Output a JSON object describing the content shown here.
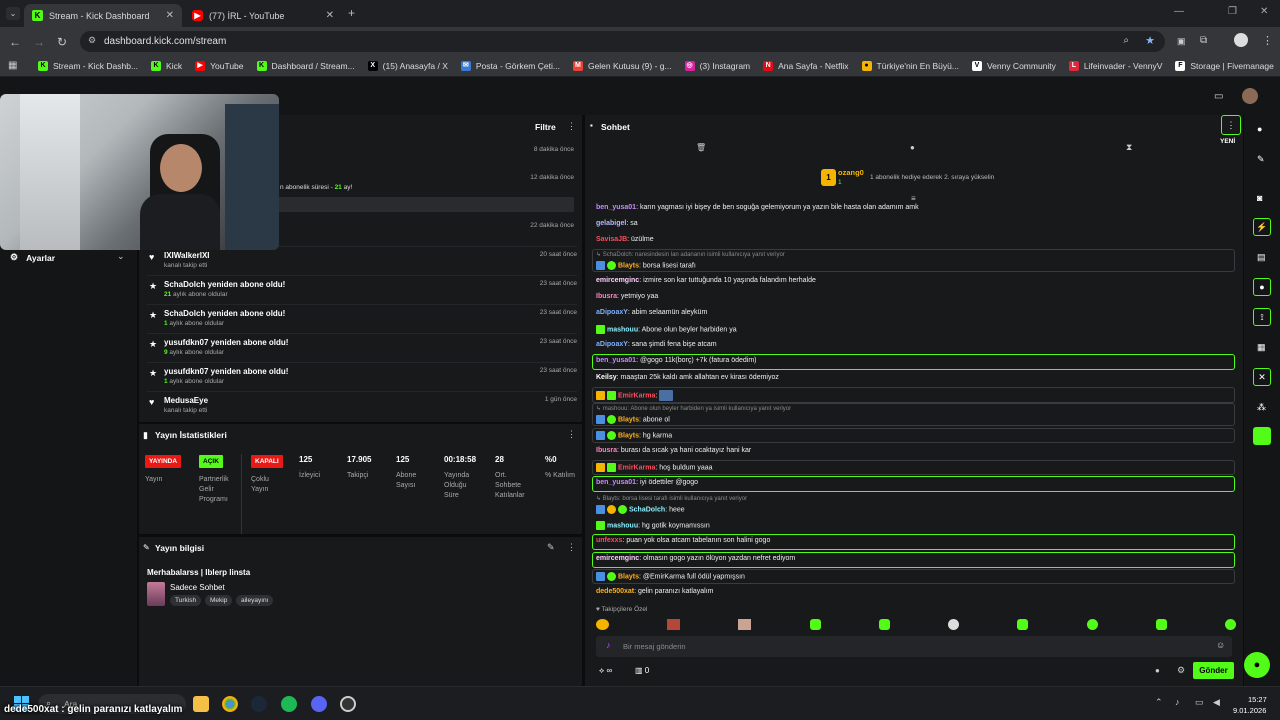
{
  "browser": {
    "tabs": [
      {
        "label": "Stream - Kick Dashboard",
        "icon": "kick-icon"
      },
      {
        "label": "(77) İRL - YouTube",
        "icon": "youtube-icon"
      }
    ],
    "url": "dashboard.kick.com/stream",
    "bookmarks": [
      "Stream - Kick Dashb...",
      "Kick",
      "YouTube",
      "Dashboard / Stream...",
      "(15) Anasayfa / X",
      "Posta - Görkem Çeti...",
      "Gelen Kutusu (9) - g...",
      "(3) Instagram",
      "Ana Sayfa - Netflix",
      "Türkiye'nin En Büyü...",
      "Venny Community",
      "Lifeinvader - VennyV",
      "Storage | Fivemanage"
    ]
  },
  "sidebar": {
    "settings_label": "Ayarlar"
  },
  "activity": {
    "title": "Filtre",
    "top_times": [
      "8 dakika önce",
      "12 dakika önce",
      "22 dakika önce"
    ],
    "sub_fragment_prefix": "n abonelik süresi - ",
    "sub_fragment_months": "21",
    "sub_fragment_suffix": " ay!",
    "events": [
      {
        "title": "IXIWalkerIXI",
        "sub": "kanalı takip etti",
        "time": "20 saat önce",
        "icon": "heart-icon"
      },
      {
        "title": "SchaDolch yeniden abone oldu!",
        "sub_num": "21",
        "sub": " aylık abone oldular",
        "time": "23 saat önce",
        "icon": "star-icon"
      },
      {
        "title": "SchaDolch yeniden abone oldu!",
        "sub_num": "1",
        "sub": " aylık abone oldular",
        "time": "23 saat önce",
        "icon": "star-icon"
      },
      {
        "title": "yusufdkn07 yeniden abone oldu!",
        "sub_num": "9",
        "sub": " aylık abone oldular",
        "time": "23 saat önce",
        "icon": "star-icon"
      },
      {
        "title": "yusufdkn07 yeniden abone oldu!",
        "sub_num": "1",
        "sub": " aylık abone oldular",
        "time": "23 saat önce",
        "icon": "star-icon"
      },
      {
        "title": "MedusaEye",
        "sub": "kanalı takip etti",
        "time": "1 gün önce",
        "icon": "heart-icon"
      }
    ]
  },
  "stats": {
    "title": "Yayın İstatistikleri",
    "badges": [
      {
        "badge": "YAYINDA",
        "label": "Yayın",
        "color": "#e91916"
      },
      {
        "badge": "AÇIK",
        "label": "Partnerlik Gelir Programı",
        "color": "#53fc18"
      },
      {
        "badge": "KAPALI",
        "label": "Çoklu Yayın",
        "color": "#e91916"
      }
    ],
    "numbers": [
      {
        "value": "125",
        "label": "İzleyici"
      },
      {
        "value": "17.905",
        "label": "Takipçi"
      },
      {
        "value": "125",
        "label": "Abone Sayısı"
      },
      {
        "value": "00:18:58",
        "label": "Yayında Olduğu Süre"
      },
      {
        "value": "28",
        "label": "Ort. Sohbete Katılanlar"
      },
      {
        "value": "%0",
        "label": "% Katılım"
      }
    ]
  },
  "info": {
    "title": "Yayın bilgisi",
    "stream_title": "Merhabalarss | Iblerp linsta",
    "category": "Sadece Sohbet",
    "tags": [
      "Turkish",
      "Mekip",
      "aileyayını"
    ]
  },
  "chat": {
    "title": "Sohbet",
    "new_label": "YENİ",
    "pinned_user": "ozang0",
    "pinned_count": "1",
    "pinned_text": "1 abonelik hediye ederek 2. sıraya yükselin",
    "messages": [
      {
        "user": "ben_yusa01",
        "color": "#c38bff",
        "text": "karın yagması iyi bişey de ben soguğa gelemiyorum ya yazın bile hasta olan adamım amk"
      },
      {
        "user": "gelabigel",
        "color": "#b9b9ff",
        "text": "sa"
      },
      {
        "user": "SavisaJB",
        "color": "#ff4b5c",
        "text": "üzülme"
      },
      {
        "reply": "SchaDolch: naresindesin lan adananın isimli kullanıcıya yanıt veriyor",
        "user": "Blayts",
        "color": "#ffb21f",
        "text": "borsa lisesi tarafı"
      },
      {
        "user": "emircemginc",
        "color": "#ffd0ff",
        "text": "izmire son kar tuttuğunda 10 yaşında falandım herhalde"
      },
      {
        "user": "Ibusra",
        "color": "#ff86c1",
        "text": "yetmiyo yaa"
      },
      {
        "user": "aDipoaxY",
        "color": "#7fb0ff",
        "text": "abim selaamün aleyküm"
      },
      {
        "user": "mashouu",
        "color": "#8ef0ff",
        "text": "Abone olun beyler harbiden ya"
      },
      {
        "user": "aDipoaxY",
        "color": "#7fb0ff",
        "text": "sana şimdi fena bişe atcam"
      },
      {
        "user": "ben_yusa01",
        "color": "#c38bff",
        "text": "@gogo 11k(borç) +7k (fatura ödedim)"
      },
      {
        "user": "Keilsy",
        "color": "#ffffff",
        "text": "maaştan 25k kaldı amk allahtan ev kirası ödemiyoz"
      },
      {
        "user": "EmirKarma",
        "color": "#ff4b5c",
        "text": ""
      },
      {
        "reply": "mashouu: Abone olun beyler harbiden ya isimli kullanıcıya yanıt veriyor",
        "user": "Blayts",
        "color": "#ffb21f",
        "text": "abone ol"
      },
      {
        "user": "Blayts",
        "color": "#ffb21f",
        "text": "hg karma"
      },
      {
        "user": "Ibusra",
        "color": "#ff86c1",
        "text": "burası da sıcak ya hani ocaktayız hani kar"
      },
      {
        "user": "EmirKarma",
        "color": "#ff4b5c",
        "text": "hoş buldum yaaa"
      },
      {
        "user": "ben_yusa01",
        "color": "#c38bff",
        "text": "iyi ödettiler @gogo"
      },
      {
        "reply": "Blayts: borsa lisesi tarafı isimli kullanıcıya yanıt veriyor",
        "user": "SchaDolch",
        "color": "#8ef0ff",
        "text": "heee"
      },
      {
        "user": "mashouu",
        "color": "#8ef0ff",
        "text": "hg gotik koymamıssın"
      },
      {
        "user": "unfexxs",
        "color": "#ff4b5c",
        "text": "puan yok olsa atcam tabelanın son halini gogo"
      },
      {
        "user": "emircemginc",
        "color": "#ffd0ff",
        "text": "olmasın gogo yazın ölüyon yazdan nefret ediyom"
      },
      {
        "user": "Blayts",
        "color": "#ffb21f",
        "text": "@EmirKarma full ödül yapmışsın"
      },
      {
        "user": "dede500xat",
        "color": "#ffb21f",
        "text": "gelin paranızı katlayalım"
      }
    ],
    "followers_label": "Takipçilere Özel",
    "input_placeholder": "Bir mesaj gönderin",
    "infinite": "∞",
    "zero": "0",
    "send_label": "Gönder"
  },
  "taskbar": {
    "search": "Ara",
    "overlay_user": "dede500xat",
    "overlay_text": "gelin paranızı katlayalım",
    "time": "15:27",
    "date": "9.01.2026"
  },
  "colors": {
    "accent": "#53fc18",
    "live": "#e91916"
  }
}
